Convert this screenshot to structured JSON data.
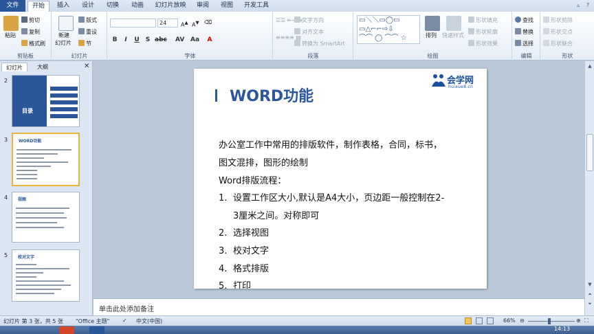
{
  "ribbon_tabs": [
    "文件",
    "开始",
    "插入",
    "设计",
    "切换",
    "动画",
    "幻灯片放映",
    "审阅",
    "视图",
    "开发工具"
  ],
  "clipboard": {
    "paste": "粘贴",
    "cut": "剪切",
    "copy": "复制",
    "format_painter": "格式刷",
    "label": "剪贴板"
  },
  "slides_group": {
    "new_slide": "新建",
    "new_slide2": "幻灯片",
    "layout": "版式",
    "reset": "重设",
    "section": "节",
    "label": "幻灯片"
  },
  "font_group": {
    "font_size": "24",
    "bold": "B",
    "italic": "I",
    "underline": "U",
    "strike": "S",
    "label": "字体"
  },
  "paragraph_group": {
    "text_direction": "文字方向",
    "align_text": "对齐文本",
    "smartart": "转换为 SmartArt",
    "label": "段落"
  },
  "drawing_group": {
    "arrange": "排列",
    "quick_styles": "快速样式",
    "shape_fill": "形状填充",
    "shape_outline": "形状轮廓",
    "shape_effects": "形状效果",
    "label": "绘图"
  },
  "editing_group": {
    "find": "查找",
    "replace": "替换",
    "select": "选择",
    "label": "编辑"
  },
  "shapes_group": {
    "subtract": "形状剪除",
    "intersect": "形状交点",
    "union": "形状联合",
    "label": "形状"
  },
  "left_pane": {
    "tab_slides": "幻灯片",
    "tab_outline": "大纲"
  },
  "thumbnails": [
    {
      "num": "2",
      "title": "目录"
    },
    {
      "num": "3",
      "title": "WORD功能"
    },
    {
      "num": "4",
      "title": "视图"
    },
    {
      "num": "5",
      "title": "校对文字"
    }
  ],
  "slide": {
    "title": "WORD功能",
    "logo": "会学网",
    "logo_url": "huixue8.cn",
    "lines": [
      "办公室工作中常用的排版软件，制作表格，合同，标书，",
      "图文混排，图形的绘制",
      "Word排版流程：",
      "设置工作区大小,默认是A4大小，页边距一般控制在2-",
      "3厘米之间。对称即可",
      "选择视图",
      "校对文字",
      "格式排版",
      "打印"
    ],
    "list_numbers": [
      "1.",
      "2.",
      "3.",
      "4.",
      "5."
    ]
  },
  "notes_placeholder": "单击此处添加备注",
  "status": {
    "slide_info": "幻灯片 第 3 张，共 5 张",
    "theme": "\"Office 主题\"",
    "language": "中文(中国)",
    "zoom": "66%",
    "time": "14:13"
  },
  "colors": {
    "accent": "#2b579a",
    "file_tab": "#2b579a",
    "thumb_selected": "#e7b33a"
  }
}
